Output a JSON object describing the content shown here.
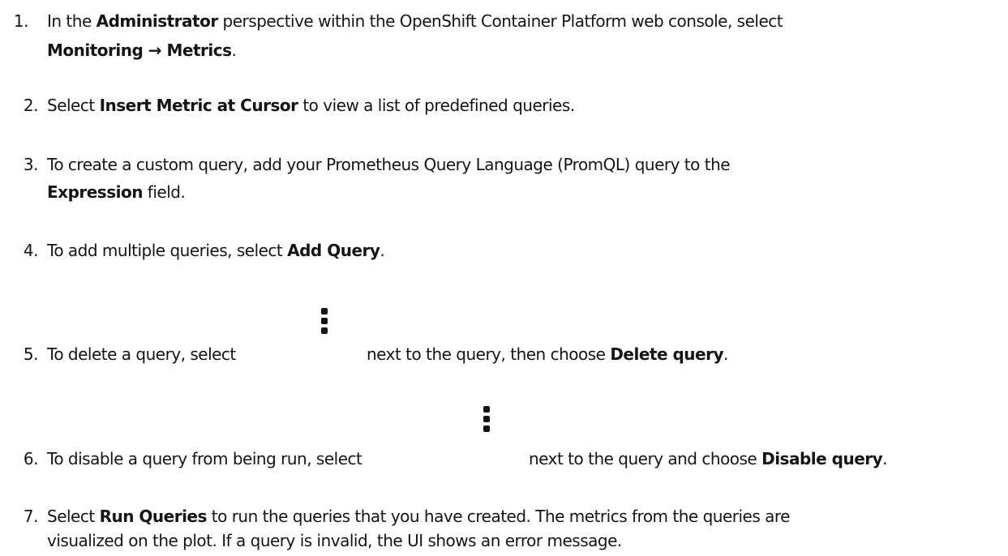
{
  "steps": [
    {
      "number": "1.",
      "line1": {
        "pre": "In the ",
        "b1": "Administrator",
        "post": " perspective within the OpenShift Container Platform web console, select"
      },
      "line2": {
        "b1": "Monitoring → Metrics",
        "post": "."
      }
    },
    {
      "number": "2.",
      "line1": {
        "pre": "Select ",
        "b1": "Insert Metric at Cursor",
        "post": " to view a list of predefined queries."
      }
    },
    {
      "number": "3.",
      "line1": {
        "pre": "To create a custom query, add your Prometheus Query Language (PromQL) query to the"
      },
      "line2": {
        "b1": "Expression",
        "post": " field."
      }
    },
    {
      "number": "4.",
      "line1": {
        "pre": "To add multiple queries, select ",
        "b1": "Add Query",
        "post": "."
      }
    },
    {
      "number": "5.",
      "line1": {
        "pre": "To delete a query, select",
        "mid": "next to the query, then choose ",
        "b1": "Delete query",
        "post": "."
      },
      "icon": "kebab-vertical-icon"
    },
    {
      "number": "6.",
      "line1": {
        "pre": "To disable a query from being run, select",
        "mid": "next to the query and choose ",
        "b1": "Disable query",
        "post": "."
      },
      "icon": "kebab-vertical-icon"
    },
    {
      "number": "7.",
      "line1": {
        "pre": "Select ",
        "b1": "Run Queries",
        "post": " to run the queries that you have created. The metrics from the queries are"
      },
      "line2": {
        "pre": "visualized on the plot. If a query is invalid, the UI shows an error message."
      }
    }
  ]
}
